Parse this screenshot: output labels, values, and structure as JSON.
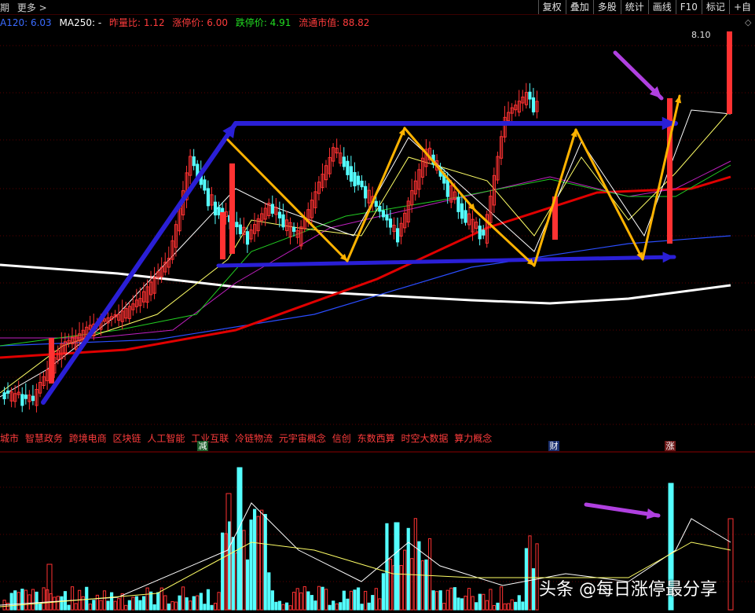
{
  "toolbar": {
    "left": [
      "期",
      "更多 >"
    ],
    "buttons": [
      "复权",
      "叠加",
      "多股",
      "统计",
      "画线",
      "F10",
      "标记",
      "+自"
    ]
  },
  "ma_line": [
    {
      "text": "A120: 6.03",
      "color": "#3a6bff"
    },
    {
      "text": "MA250: -",
      "color": "#ffffff"
    },
    {
      "text": "昨量比: 1.12",
      "color": "#ff3c3c"
    },
    {
      "text": "涨停价: 6.00",
      "color": "#ff3c3c"
    },
    {
      "text": "跌停价: 4.91",
      "color": "#22dd22"
    },
    {
      "text": "流通市值: 88.82",
      "color": "#ff3c3c"
    }
  ],
  "price_label": "8.10",
  "concepts": [
    "城市",
    "智慧政务",
    "跨境电商",
    "区块链",
    "人工智能",
    "工业互联",
    "冷链物流",
    "元宇宙概念",
    "信创",
    "东数西算",
    "时空大数据",
    "算力概念"
  ],
  "markers": [
    {
      "text": "减",
      "bg": "#1a5e2a",
      "color": "#ffffff"
    },
    {
      "text": "财",
      "bg": "#1a2f6e",
      "color": "#ffffff"
    },
    {
      "text": "涨",
      "bg": "#6e1a1a",
      "color": "#ffffff"
    }
  ],
  "watermark": "头条 @每日涨停最分享",
  "colors": {
    "up": "#ff3232",
    "down": "#54ffff",
    "annotation_blue": "#2a1fd6",
    "annotation_orange": "#ffb300",
    "annotation_purple": "#b040e0"
  }
}
